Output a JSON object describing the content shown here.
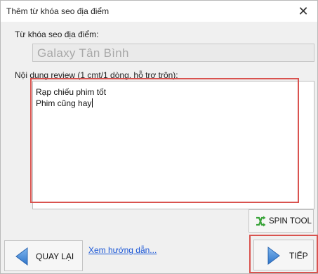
{
  "window": {
    "title": "Thêm từ khóa seo địa điểm",
    "close_glyph": "✕"
  },
  "place": {
    "label": "Từ khóa seo địa điểm:",
    "value": "Galaxy Tân Bình"
  },
  "review": {
    "label": "Nội dung review (1 cmt/1 dòng, hỗ trợ trộn):",
    "lines": [
      "Rạp chiếu phim tốt",
      "Phim cũng hay"
    ]
  },
  "buttons": {
    "spin_tool": "SPIN TOOL",
    "back": "QUAY LẠI",
    "next": "TIẾP"
  },
  "guide_link": "Xem hướng dẫn...",
  "colors": {
    "highlight": "#d9534f",
    "link": "#1a56d6",
    "arrow": "#4a8fd8",
    "spin_icon": "#3aa43a"
  },
  "icons": {
    "close": "close-icon",
    "spin": "shuffle-icon",
    "back": "arrow-left-icon",
    "next": "arrow-right-icon"
  }
}
